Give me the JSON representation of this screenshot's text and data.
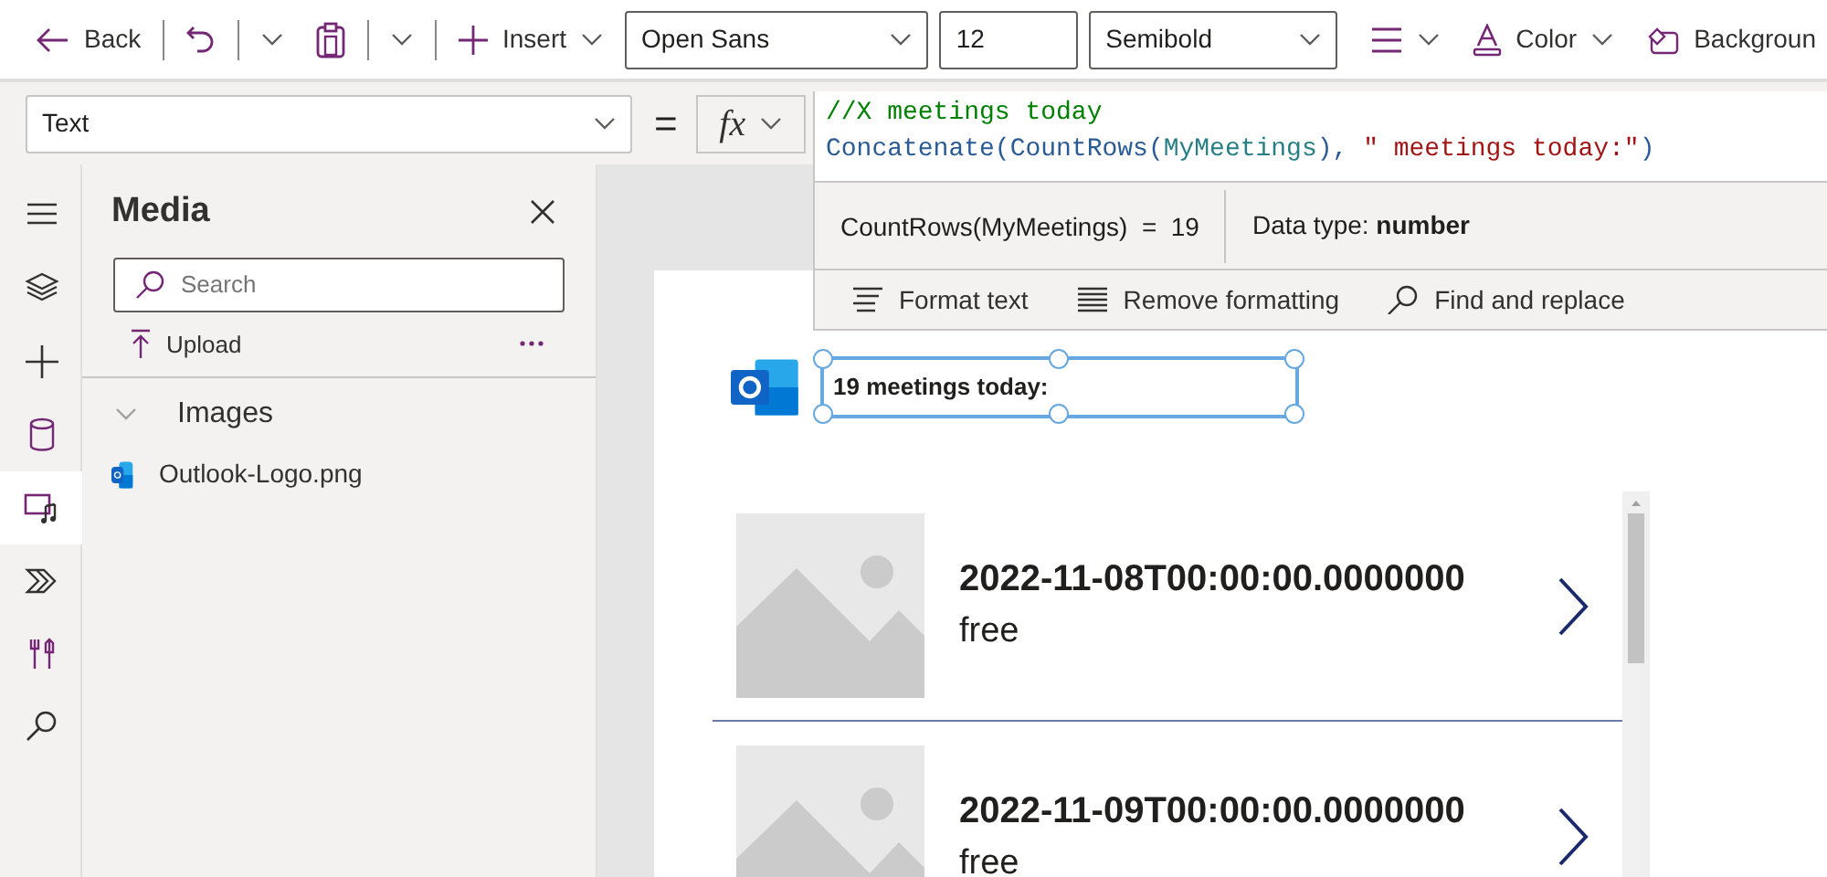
{
  "toolbar": {
    "back": "Back",
    "insert": "Insert",
    "font": "Open Sans",
    "size": "12",
    "weight": "Semibold",
    "color_label": "Color",
    "background": "Backgroun"
  },
  "formula_bar": {
    "property": "Text",
    "equals": "=",
    "fx": "fx",
    "lines": [
      [
        {
          "kind": "comment",
          "text": "//X meetings today"
        }
      ],
      [
        {
          "kind": "function",
          "text": "Concatenate("
        },
        {
          "kind": "function",
          "text": "CountRows("
        },
        {
          "kind": "identifier",
          "text": "MyMeetings"
        },
        {
          "kind": "function",
          "text": "),"
        },
        {
          "kind": "string",
          "text": " \" meetings today:\""
        },
        {
          "kind": "function",
          "text": ")"
        }
      ]
    ],
    "result": {
      "expression": "CountRows(MyMeetings)",
      "equals": "=",
      "value": "19",
      "data_type": "Data type: **number**"
    },
    "actions": [
      {
        "kind": "format",
        "label": "Format text"
      },
      {
        "kind": "remove",
        "label": "Remove formatting"
      },
      {
        "kind": "find",
        "label": "Find and replace"
      }
    ]
  },
  "rail": [
    {
      "kind": "menu",
      "selected": false
    },
    {
      "kind": "layers",
      "selected": false
    },
    {
      "kind": "plus",
      "selected": false
    },
    {
      "kind": "data",
      "selected": false
    },
    {
      "kind": "media",
      "selected": true
    },
    {
      "kind": "flow",
      "selected": false
    },
    {
      "kind": "tools",
      "selected": false
    },
    {
      "kind": "search",
      "selected": false
    }
  ],
  "media_panel": {
    "title": "Media",
    "search": {
      "placeholder": "Search"
    },
    "upload": "Upload",
    "section": {
      "label": "Images",
      "expanded": true,
      "files": [
        "Outlook-Logo.png"
      ]
    }
  },
  "canvas": {
    "label": {
      "text": "19 meetings today:",
      "selected": true
    },
    "gallery": [
      {
        "title": "2022-11-08T00:00:00.0000000",
        "subtitle": "free"
      },
      {
        "title": "2022-11-09T00:00:00.0000000",
        "subtitle": "free"
      }
    ]
  }
}
